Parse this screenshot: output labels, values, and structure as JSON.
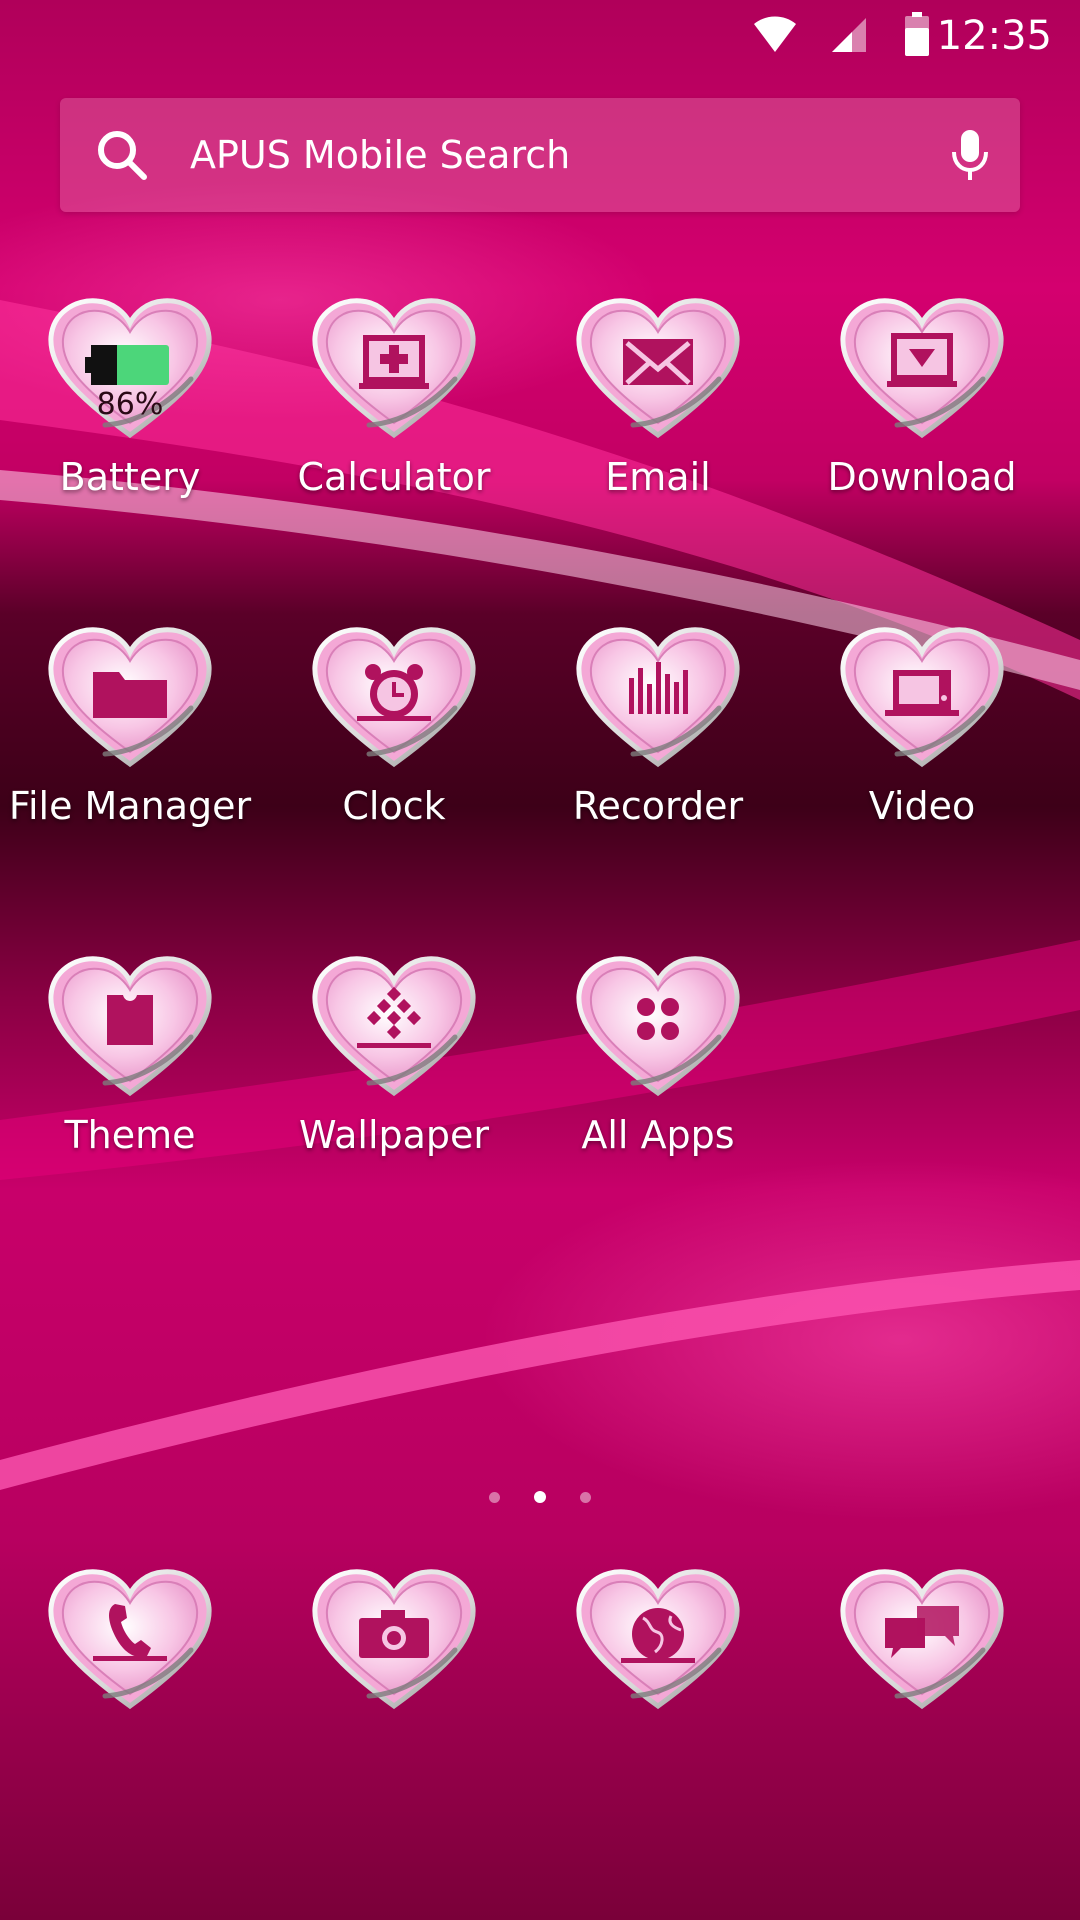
{
  "status_bar": {
    "time": "12:35",
    "icons": [
      "wifi-icon",
      "cell-signal-icon",
      "battery-icon"
    ]
  },
  "search": {
    "placeholder": "APUS Mobile Search",
    "left_icon": "search-icon",
    "right_icon": "microphone-icon"
  },
  "apps": [
    {
      "label": "Battery",
      "icon": "battery-app-icon",
      "extra": "86%"
    },
    {
      "label": "Calculator",
      "icon": "calculator-icon"
    },
    {
      "label": "Email",
      "icon": "envelope-icon"
    },
    {
      "label": "Download",
      "icon": "download-icon"
    },
    {
      "label": "File Manager",
      "icon": "folder-icon"
    },
    {
      "label": "Clock",
      "icon": "alarm-clock-icon"
    },
    {
      "label": "Recorder",
      "icon": "sound-wave-icon"
    },
    {
      "label": "Video",
      "icon": "video-icon"
    },
    {
      "label": "Theme",
      "icon": "shirt-icon"
    },
    {
      "label": "Wallpaper",
      "icon": "wallpaper-icon"
    },
    {
      "label": "All Apps",
      "icon": "apps-grid-icon"
    }
  ],
  "pager": {
    "count": 3,
    "active_index": 1
  },
  "dock": [
    {
      "icon": "phone-icon"
    },
    {
      "icon": "camera-icon"
    },
    {
      "icon": "globe-icon"
    },
    {
      "icon": "chat-bubbles-icon"
    }
  ],
  "colors": {
    "wallpaper_base": "#a3004f",
    "heart_fill": "#f7bde0",
    "glyph": "#b0125e",
    "battery_green": "#4cd67a"
  }
}
